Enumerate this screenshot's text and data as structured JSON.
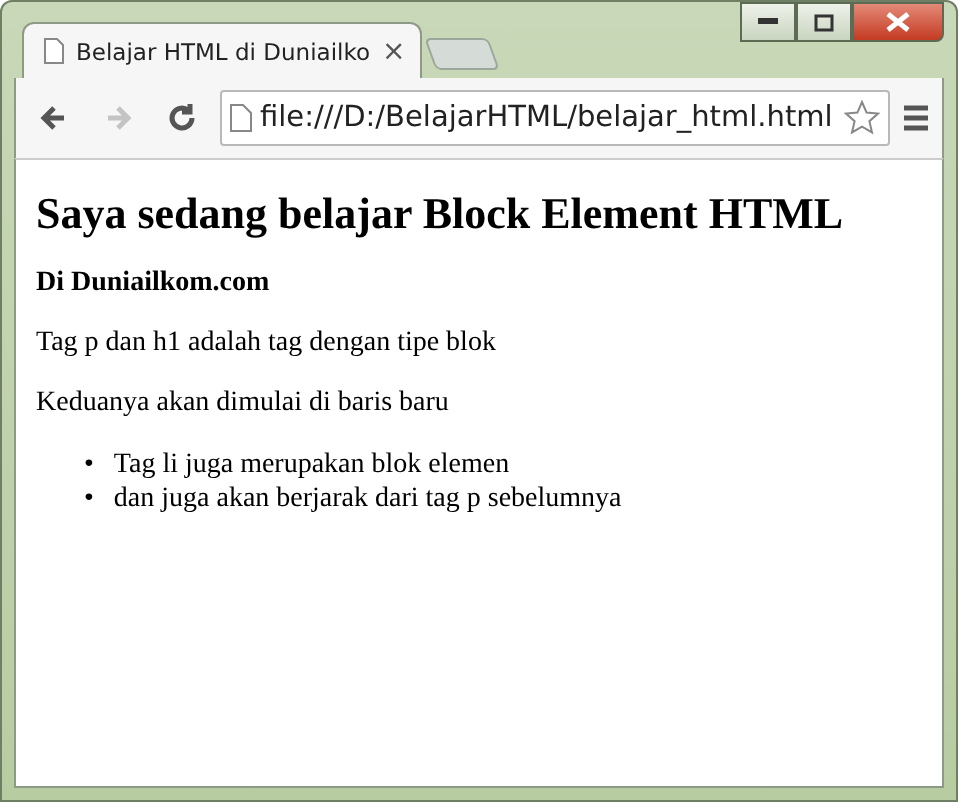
{
  "tabs": [
    {
      "title": "Belajar HTML di Duniailko",
      "close": "×",
      "selected": true
    }
  ],
  "nav": [
    {
      "kind": "back",
      "disabled": false
    },
    {
      "kind": "forward",
      "disabled": true
    },
    {
      "kind": "reload",
      "disabled": false
    }
  ],
  "address": {
    "value": "file:///D:/BelajarHTML/belajar_html.html"
  },
  "content": [
    {
      "kind": "h1",
      "text": "Saya sedang belajar Block Element HTML"
    },
    {
      "kind": "h4",
      "text": "Di Duniailkom.com"
    },
    {
      "kind": "p",
      "text": "Tag p dan h1 adalah tag dengan tipe blok"
    },
    {
      "kind": "p",
      "text": "Keduanya akan dimulai di baris baru"
    },
    {
      "kind": "ul",
      "items": [
        {
          "bullet": "•",
          "text": "Tag li juga merupakan blok elemen"
        },
        {
          "bullet": "•",
          "text": "dan juga akan berjarak dari tag p sebelumnya"
        }
      ]
    }
  ]
}
